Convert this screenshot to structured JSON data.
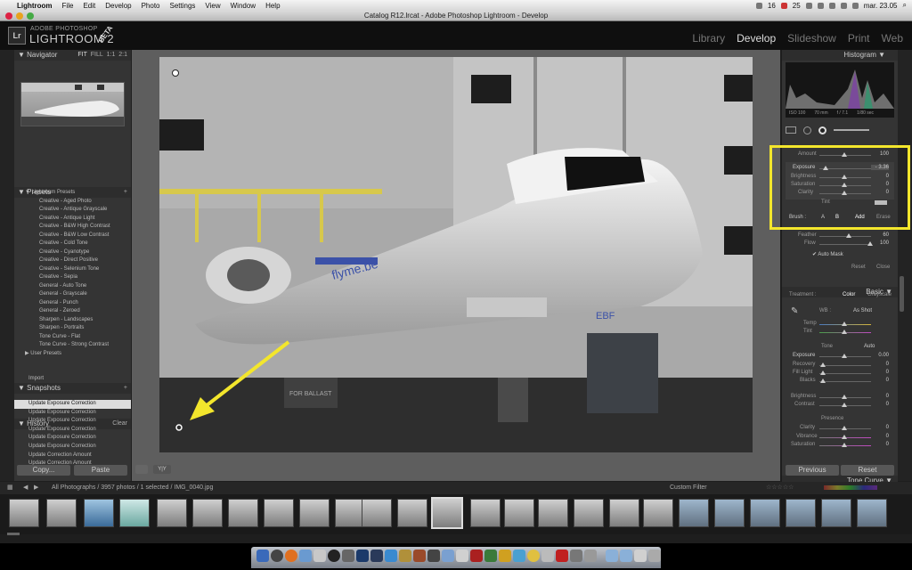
{
  "menubar": {
    "app": "Lightroom",
    "items": [
      "File",
      "Edit",
      "Develop",
      "Photo",
      "Settings",
      "View",
      "Window",
      "Help"
    ],
    "status": [
      "16",
      "25",
      "mar. 23.05"
    ]
  },
  "window": {
    "title": "Catalog R12.lrcat - Adobe Photoshop Lightroom - Develop"
  },
  "header": {
    "logo_badge": "Lr",
    "logo_top": "ADOBE PHOTOSHOP",
    "logo_main": "LIGHTROOM 2",
    "logo_beta": "BETA",
    "modules": [
      "Library",
      "Develop",
      "Slideshow",
      "Print",
      "Web"
    ],
    "active_module": "Develop"
  },
  "left": {
    "navigator": {
      "title": "Navigator",
      "zoom": [
        "FIT",
        "FILL",
        "1:1",
        "2:1"
      ]
    },
    "presets": {
      "title": "Presets",
      "folder": "Lightroom Presets",
      "items": [
        "Creative - Aged Photo",
        "Creative - Antique Grayscale",
        "Creative - Antique Light",
        "Creative - B&W High Contrast",
        "Creative - B&W Low Contrast",
        "Creative - Cold Tone",
        "Creative - Cyanotype",
        "Creative - Direct Positive",
        "Creative - Selenium Tone",
        "Creative - Sepia",
        "General - Auto Tone",
        "General - Grayscale",
        "General - Punch",
        "General - Zeroed",
        "Sharpen - Landscapes",
        "Sharpen - Portraits",
        "Tone Curve - Flat",
        "Tone Curve - Strong Contrast"
      ],
      "user_folder": "User Presets"
    },
    "snapshots": {
      "title": "Snapshots",
      "items": [
        "Import"
      ]
    },
    "history": {
      "title": "History",
      "clear": "Clear",
      "items": [
        "Update Exposure Correction",
        "Update Exposure Correction",
        "Update Exposure Correction",
        "Update Exposure Correction",
        "Update Exposure Correction",
        "Update Exposure Correction",
        "Update Correction Amount",
        "Update Correction Amount"
      ]
    },
    "copy": "Copy...",
    "paste": "Paste"
  },
  "right": {
    "histogram": {
      "title": "Histogram",
      "info": [
        "ISO 100",
        "70 mm",
        "f / 7.1",
        "1/80 sec"
      ]
    },
    "brush": {
      "amount_label": "Amount",
      "amount": "100",
      "exposure_label": "Exposure",
      "exposure": "- 3.36",
      "brightness_label": "Brightness",
      "brightness": "0",
      "saturation_label": "Saturation",
      "saturation": "0",
      "clarity_label": "Clarity",
      "clarity": "0",
      "tint_label": "Tint",
      "brush_label": "Brush :",
      "a": "A",
      "b": "B",
      "add": "Add",
      "erase": "Erase",
      "feather_label": "Feather",
      "feather": "60",
      "flow_label": "Flow",
      "flow": "100",
      "automask": "Auto Mask",
      "reset": "Reset",
      "close": "Close"
    },
    "basic": {
      "title": "Basic",
      "treatment": "Treatment :",
      "color": "Color",
      "grayscale": "Grayscale",
      "wb": "WB :",
      "wb_value": "As Shot",
      "temp": "Temp",
      "tint": "Tint",
      "tone": "Tone",
      "auto": "Auto",
      "exposure": "Exposure",
      "exposure_val": "0.00",
      "recovery": "Recovery",
      "fill": "Fill Light",
      "blacks": "Blacks",
      "brightness": "Brightness",
      "contrast": "Contrast",
      "presence": "Presence",
      "clarity": "Clarity",
      "vibrance": "Vibrance",
      "saturation": "Saturation",
      "zero": "0",
      "tonecurve": "Tone Curve"
    },
    "previous": "Previous",
    "reset": "Reset"
  },
  "filmstrip": {
    "path": "All Photographs / 3957 photos / 1 selected / IMG_0040.jpg",
    "filter": "Custom Filter"
  },
  "photo": {
    "sign": "FOR BALLAST",
    "livery": "flyme.be",
    "code": "EBF"
  },
  "colors": {
    "highlight": "#f3e62c",
    "arrow": "#f3e62c"
  }
}
